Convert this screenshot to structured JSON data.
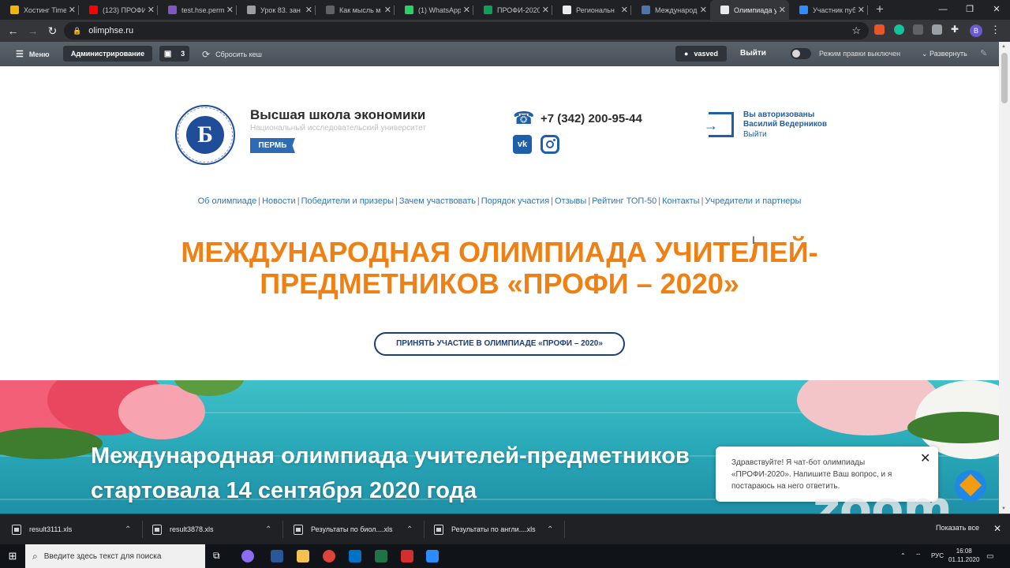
{
  "browser": {
    "tabs": [
      {
        "title": "Хостинг Time",
        "color": "#f4b400"
      },
      {
        "title": "(123) ПРОФИ",
        "color": "#ff0000"
      },
      {
        "title": "test.hse.perm",
        "color": "#7e57c2"
      },
      {
        "title": "Урок 83. зан",
        "color": "#9e9e9e"
      },
      {
        "title": "Как мысль м",
        "color": "#5f6368"
      },
      {
        "title": "(1) WhatsApp",
        "color": "#25d366"
      },
      {
        "title": "ПРОФИ-2020",
        "color": "#0f9d58"
      },
      {
        "title": "Региональн",
        "color": "#e8eaed"
      },
      {
        "title": "Международ",
        "color": "#4a76a8"
      },
      {
        "title": "Олимпиада у",
        "color": "#e8eaed"
      },
      {
        "title": "Участник пуб",
        "color": "#2d8cff"
      }
    ],
    "new_tab": "+",
    "url": "olimphse.ru",
    "profile_initial": "B"
  },
  "admin_bar": {
    "menu": "Меню",
    "administration": "Администрирование",
    "counter": "3",
    "reset_cache": "Сбросить кеш",
    "user": "vasved",
    "logout": "Выйти",
    "edit_mode": "Режим правки выключен",
    "expand": "Развернуть"
  },
  "header": {
    "logo_letter": "Б",
    "university_name": "Высшая школа экономики",
    "university_subtitle": "Национальный исследовательский университет",
    "city_badge": "ПЕРМЬ",
    "phone": "+7 (342) 200-95-44",
    "vk_label": "vk",
    "auth_line1": "Вы авторизованы",
    "auth_line2": "Василий Ведерников",
    "auth_logout": "Выйти"
  },
  "nav": {
    "items": [
      "Об олимпиаде",
      "Новости",
      "Победители и призеры",
      "Зачем участвовать",
      "Порядок участия",
      "Отзывы",
      "Рейтинг ТОП-50",
      "Контакты",
      "Учредители и партнеры"
    ]
  },
  "main": {
    "title_line1": "МЕЖДУНАРОДНАЯ ОЛИМПИАДА УЧИТЕЛЕЙ-",
    "title_line2": "ПРЕДМЕТНИКОВ «ПРОФИ – 2020»",
    "cta": "ПРИНЯТЬ УЧАСТИЕ В ОЛИМПИАДЕ «ПРОФИ – 2020»",
    "hero_line1": "Международная олимпиада учителей-предметников",
    "hero_line2": "стартовала 14 сентября 2020 года"
  },
  "chat": {
    "message": "Здравствуйте! Я чат-бот олимпиады «ПРОФИ-2020». Напишите Ваш вопрос, и я постараюсь на него ответить.",
    "close": "✕"
  },
  "zoom_watermark": "zoom",
  "downloads": {
    "items": [
      "result3111.xls",
      "result3878.xls",
      "Результаты по биол....xls",
      "Результаты по англи....xls"
    ],
    "show_all": "Показать все"
  },
  "taskbar": {
    "search_placeholder": "Введите здесь текст для поиска",
    "language": "РУС",
    "time": "16:08",
    "date": "01.11.2020"
  },
  "colors": {
    "accent_orange": "#ee8014",
    "hse_blue": "#1f4d9a",
    "link_blue": "#2a77b8"
  }
}
